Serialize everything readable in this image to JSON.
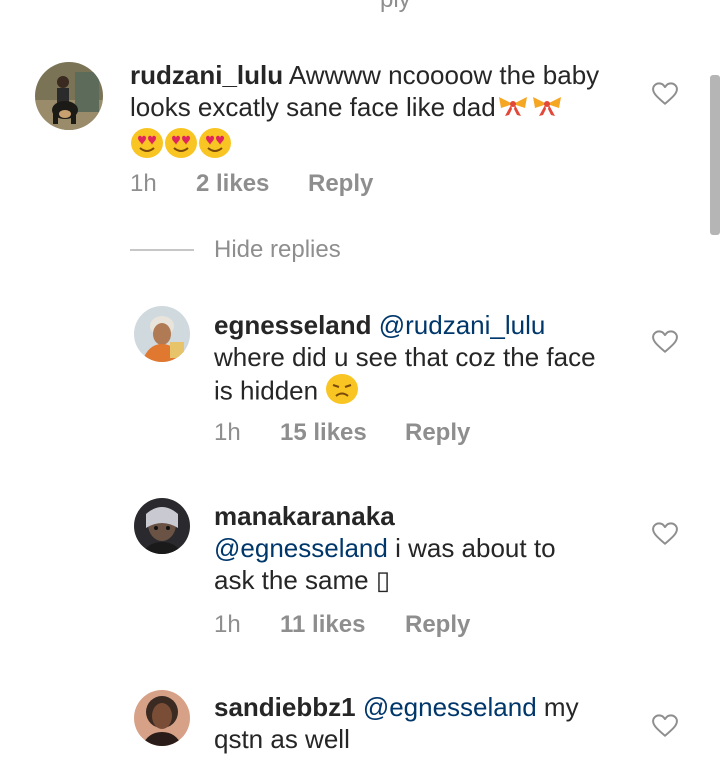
{
  "top_partial_text": "ply",
  "comments": [
    {
      "username": "rudzani_lulu",
      "mention": "",
      "text": "Awwww ncoooow the baby looks excatly sane face like dad",
      "time": "1h",
      "likes": "2 likes",
      "reply": "Reply"
    },
    {
      "username": "egnesseland",
      "mention": "@rudzani_lulu",
      "text_line2": "where did u see that coz the face",
      "text_line3": "is hidden",
      "time": "1h",
      "likes": "15 likes",
      "reply": "Reply"
    },
    {
      "username": "manakaranaka",
      "mention": "@egnesseland",
      "text_rest": "i was about to",
      "text_line3": "ask the same",
      "trailing_glyph": "▯",
      "time": "1h",
      "likes": "11 likes",
      "reply": "Reply"
    },
    {
      "username": "sandiebbz1",
      "mention": "@egnesseland",
      "text_rest": "my",
      "text_line2": "qstn as well"
    }
  ],
  "hide_replies_label": "Hide replies",
  "icons": {
    "like": "heart-outline-icon",
    "ribbon": "ribbon-emoji",
    "heart_eyes": "heart-eyes-emoji",
    "sad": "sad-face-emoji"
  },
  "colors": {
    "text": "#262626",
    "muted": "#8e8e8e",
    "mention": "#00376b"
  }
}
